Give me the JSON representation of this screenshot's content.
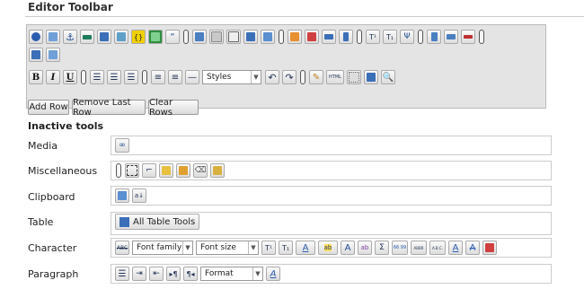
{
  "page_title": "Editor Toolbar",
  "toolbar": {
    "row1_icons": [
      "spell-check-icon",
      "web-widget-icon",
      "anchor-icon",
      "horizontal-rule-icon",
      "edit-link-icon",
      "color-picker-icon",
      "source-code-icon",
      "image-icon",
      "blockquote-icon",
      "separator",
      "paste-text-icon",
      "paste-icon",
      "copy-icon",
      "paste-word-icon",
      "paste-special-icon",
      "separator",
      "insert-form-icon",
      "insert-field-icon",
      "table-row-icon",
      "table-column-icon",
      "separator",
      "superscript-icon",
      "subscript-icon",
      "merge-cells-icon",
      "separator",
      "split-cells-icon",
      "insert-cell-icon",
      "delete-cell-icon",
      "separator",
      "table-icon",
      "table-grid-icon"
    ],
    "row2_left": [
      "bold-icon",
      "italic-icon",
      "underline-icon",
      "separator",
      "align-left-icon",
      "align-center-icon",
      "align-right-icon",
      "separator",
      "bullet-list-icon",
      "numbered-list-icon",
      "horizontal-line-icon"
    ],
    "bold_label": "B",
    "italic_label": "I",
    "underline_label": "U",
    "styles_label": "Styles",
    "row2_right": [
      "undo-icon",
      "redo-icon",
      "separator",
      "clean-icon",
      "html-icon",
      "template-icon",
      "preview-icon",
      "search-icon"
    ],
    "html_label": "HTML"
  },
  "actions": {
    "add_row": "Add Row",
    "remove_last_row": "Remove Last Row",
    "clear_rows": "Clear Rows"
  },
  "inactive": {
    "heading": "Inactive tools",
    "categories": [
      {
        "label": "Media"
      },
      {
        "label": "Miscellaneous"
      },
      {
        "label": "Clipboard"
      },
      {
        "label": "Table",
        "button_label": "All Table Tools"
      },
      {
        "label": "Character",
        "font_family": "Font family",
        "font_size": "Font size",
        "super": "T¹",
        "sub": "T₁",
        "font_color": "A",
        "highlight": "ab",
        "case": "A",
        "sigma": "Σ",
        "quote": "66 99",
        "abbr": "ABBR",
        "acronym": "A.B.C.",
        "underline_a": "A",
        "strike_a": "A"
      },
      {
        "label": "Paragraph",
        "format_label": "Format"
      }
    ]
  },
  "colors": {
    "toolbar_bg": "#e4e4e4",
    "button_border": "#aaaaaa",
    "accent_blue": "#2a5db0"
  }
}
